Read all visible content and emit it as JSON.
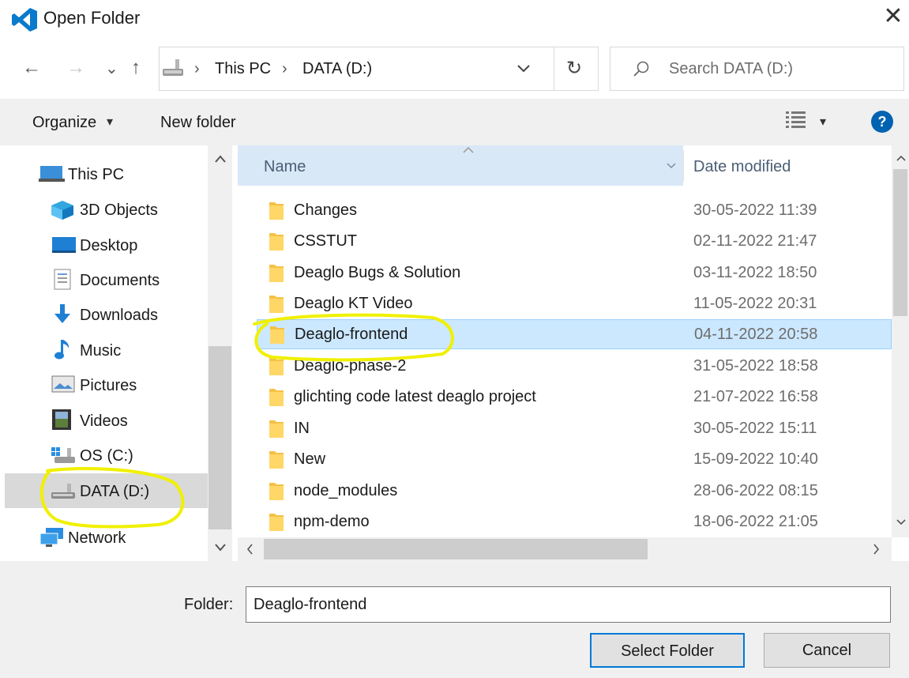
{
  "window": {
    "title": "Open Folder",
    "close_glyph": "✕"
  },
  "nav": {
    "back_glyph": "←",
    "forward_glyph": "→",
    "recent_glyph": "⌄",
    "up_glyph": "↑",
    "refresh_glyph": "↻"
  },
  "address": {
    "crumbs": [
      "This PC",
      "DATA (D:)"
    ],
    "separator": "›"
  },
  "search": {
    "placeholder": "Search DATA (D:)"
  },
  "toolbar": {
    "organize_label": "Organize",
    "organize_arrow": "▾",
    "new_folder_label": "New folder",
    "view_arrow": "▾",
    "help_glyph": "?"
  },
  "sidebar": {
    "items": [
      {
        "label": "This PC",
        "icon": "this-pc-icon"
      },
      {
        "label": "3D Objects",
        "icon": "3d-objects-icon"
      },
      {
        "label": "Desktop",
        "icon": "desktop-icon"
      },
      {
        "label": "Documents",
        "icon": "documents-icon"
      },
      {
        "label": "Downloads",
        "icon": "downloads-icon"
      },
      {
        "label": "Music",
        "icon": "music-icon"
      },
      {
        "label": "Pictures",
        "icon": "pictures-icon"
      },
      {
        "label": "Videos",
        "icon": "videos-icon"
      },
      {
        "label": "OS (C:)",
        "icon": "os-drive-icon"
      },
      {
        "label": "DATA (D:)",
        "icon": "data-drive-icon",
        "selected": true
      },
      {
        "label": "Network",
        "icon": "network-icon"
      }
    ]
  },
  "file_list": {
    "columns": {
      "name": "Name",
      "date": "Date modified"
    },
    "rows": [
      {
        "name": "Changes",
        "date": "30-05-2022 11:39"
      },
      {
        "name": "CSSTUT",
        "date": "02-11-2022 21:47"
      },
      {
        "name": "Deaglo Bugs & Solution",
        "date": "03-11-2022 18:50"
      },
      {
        "name": "Deaglo KT Video",
        "date": "11-05-2022 20:31"
      },
      {
        "name": "Deaglo-frontend",
        "date": "04-11-2022 20:58",
        "selected": true
      },
      {
        "name": "Deaglo-phase-2",
        "date": "31-05-2022 18:58"
      },
      {
        "name": "glichting code latest deaglo project",
        "date": "21-07-2022 16:58"
      },
      {
        "name": "IN",
        "date": "30-05-2022 15:11"
      },
      {
        "name": "New",
        "date": "15-09-2022 10:40"
      },
      {
        "name": "node_modules",
        "date": "28-06-2022 08:15"
      },
      {
        "name": "npm-demo",
        "date": "18-06-2022 21:05"
      }
    ]
  },
  "footer": {
    "folder_label": "Folder:",
    "folder_value": "Deaglo-frontend",
    "select_button": "Select Folder",
    "cancel_button": "Cancel"
  },
  "colors": {
    "accent": "#0078d7",
    "selection": "#cce8ff",
    "folder": "#f4c146",
    "highlighter": "#f0f000"
  }
}
